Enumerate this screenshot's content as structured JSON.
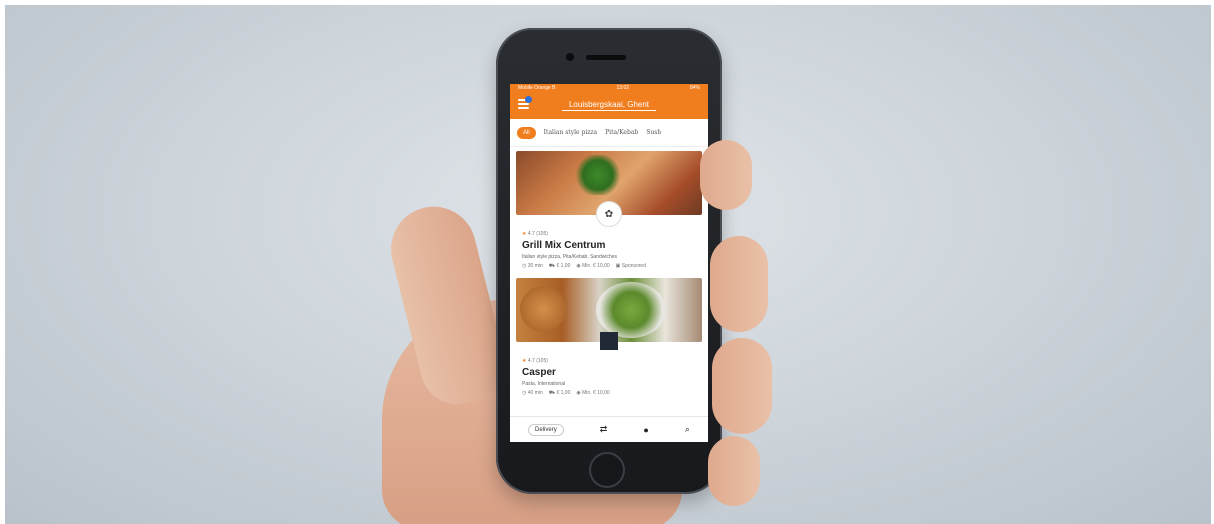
{
  "app": {
    "status_bar": {
      "carrier": "Mobile Orange B",
      "time": "13:02",
      "battery": "84%"
    },
    "address": "Louisbergskaai, Ghent",
    "categories": [
      "All",
      "Italian style pizza",
      "Pita/Kebab",
      "Sush"
    ],
    "restaurants": [
      {
        "rating": "4.7 (105)",
        "name": "Grill Mix Centrum",
        "cuisines": "Italian style pizza, Pita/Kebab, Sandwiches",
        "delivery_time": "30 min",
        "delivery_fee": "€ 1,00",
        "min_order": "Min. € 10,00",
        "tag": "Sponsored"
      },
      {
        "rating": "4.7 (105)",
        "name": "Casper",
        "cuisines": "Pasta, International",
        "delivery_time": "40 min",
        "delivery_fee": "€ 1,00",
        "min_order": "Min. € 10,00"
      }
    ],
    "bottom_nav": {
      "delivery_label": "Delivery"
    }
  },
  "colors": {
    "brand": "#f07d1e"
  }
}
